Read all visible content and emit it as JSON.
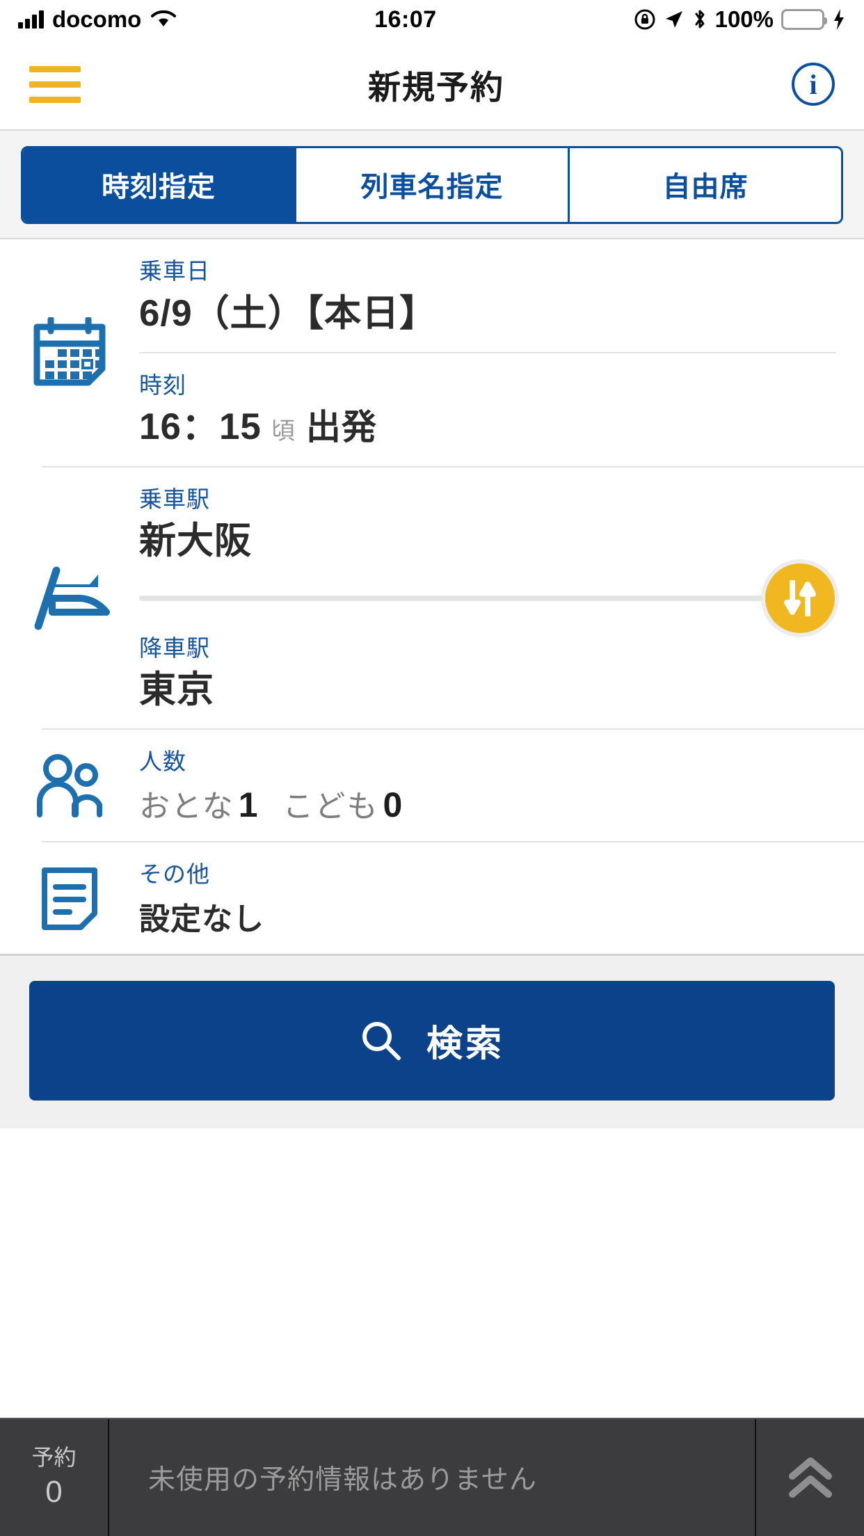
{
  "status_bar": {
    "carrier": "docomo",
    "time": "16:07",
    "battery_percent": "100%",
    "icons": [
      "signal-bars-icon",
      "wifi-icon",
      "rotation-lock-icon",
      "location-arrow-icon",
      "bluetooth-icon",
      "battery-icon",
      "charging-bolt-icon"
    ]
  },
  "header": {
    "title": "新規予約",
    "menu_icon": "hamburger-menu-icon",
    "info_icon": "info-circle-icon",
    "menu_color": "#f0b323",
    "accent_color": "#0a4f9e"
  },
  "tabs": [
    {
      "label": "時刻指定",
      "active": true
    },
    {
      "label": "列車名指定",
      "active": false
    },
    {
      "label": "自由席",
      "active": false
    }
  ],
  "form": {
    "date": {
      "label": "乗車日",
      "value": "6/9（土）【本日】",
      "icon": "calendar-icon"
    },
    "time": {
      "label": "時刻",
      "value": "16：15",
      "suffix": "頃",
      "mode": "出発"
    },
    "departure_station": {
      "label": "乗車駅",
      "value": "新大阪",
      "icon": "shinkansen-icon"
    },
    "arrival_station": {
      "label": "降車駅",
      "value": "東京"
    },
    "swap": {
      "icon": "swap-vertical-arrows-icon",
      "color": "#f0b81e"
    },
    "passengers": {
      "label": "人数",
      "icon": "people-icon",
      "adult_label": "おとな",
      "adult_count": "1",
      "child_label": "こども",
      "child_count": "0"
    },
    "other": {
      "label": "その他",
      "value": "設定なし",
      "icon": "document-note-icon"
    }
  },
  "search": {
    "label": "検索",
    "icon": "search-magnifier-icon",
    "color": "#0c4289"
  },
  "bottom_bar": {
    "reserve_label": "予約",
    "reserve_count": "0",
    "message": "未使用の予約情報はありません",
    "expand_icon": "double-chevron-up-icon",
    "background": "#3c3c3e"
  }
}
